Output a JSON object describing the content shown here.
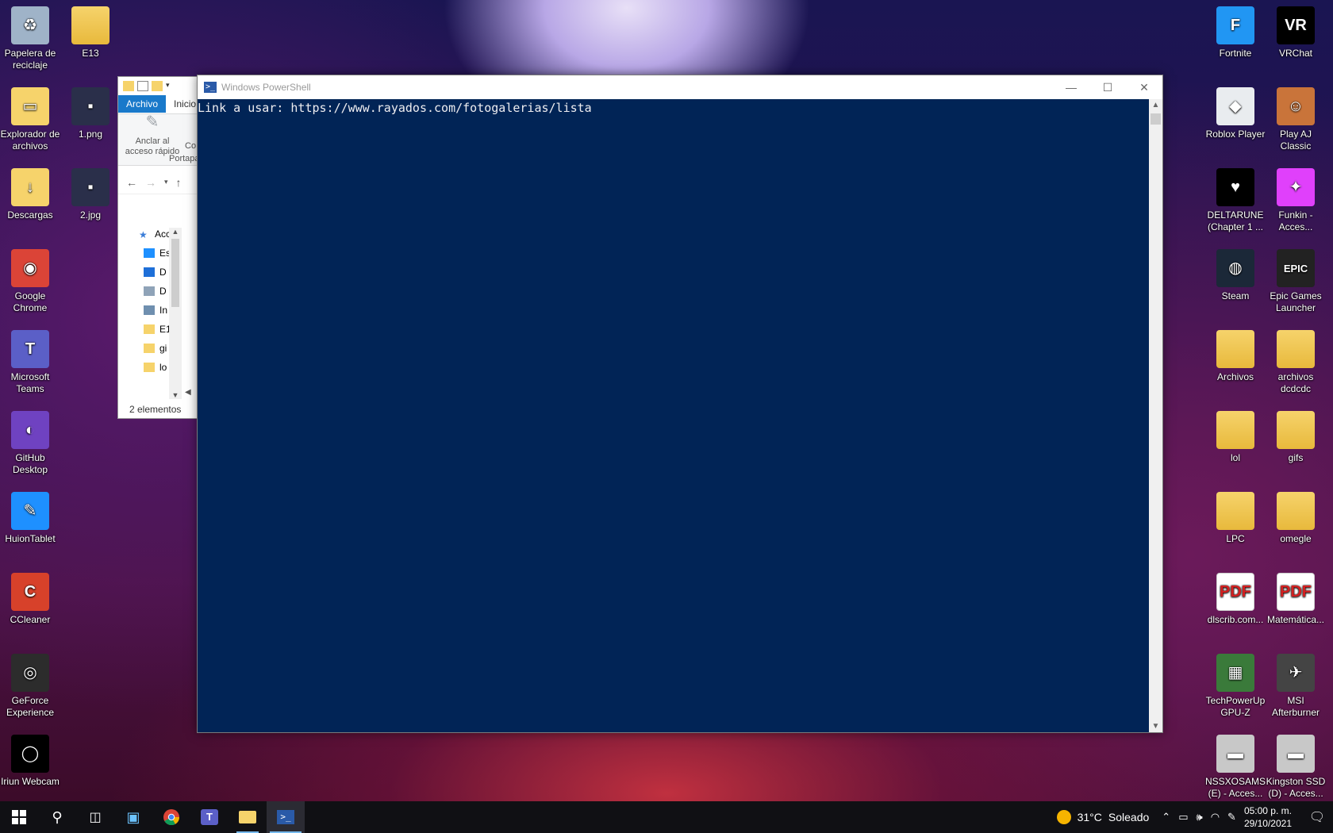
{
  "desktop": {
    "left_icons": [
      {
        "label": "Papelera de reciclaje",
        "icon": "recycle-bin-icon",
        "glyph": "♻"
      },
      {
        "label": "E13",
        "icon": "folder-icon",
        "glyph": ""
      },
      {
        "label": "Explorador de archivos",
        "icon": "file-explorer-icon",
        "glyph": "▭"
      },
      {
        "label": "1.png",
        "icon": "image-file-icon",
        "glyph": "▪"
      },
      {
        "label": "Descargas",
        "icon": "downloads-folder-icon",
        "glyph": "↓"
      },
      {
        "label": "2.jpg",
        "icon": "image-file-icon",
        "glyph": "▪"
      },
      {
        "label": "Google Chrome",
        "icon": "chrome-icon",
        "glyph": "◉"
      },
      {
        "label": "Microsoft Teams",
        "icon": "teams-icon",
        "glyph": "T"
      },
      {
        "label": "GitHub Desktop",
        "icon": "github-icon",
        "glyph": "◐"
      },
      {
        "label": "HuionTablet",
        "icon": "huion-tablet-icon",
        "glyph": "✎"
      },
      {
        "label": "CCleaner",
        "icon": "ccleaner-icon",
        "glyph": "C"
      },
      {
        "label": "GeForce Experience",
        "icon": "geforce-icon",
        "glyph": "◎"
      },
      {
        "label": "Iriun Webcam",
        "icon": "iriun-webcam-icon",
        "glyph": "◯"
      }
    ],
    "right_icons": [
      {
        "label": "Fortnite",
        "icon": "fortnite-icon",
        "glyph": "F"
      },
      {
        "label": "VRChat",
        "icon": "vrchat-icon",
        "glyph": "VR"
      },
      {
        "label": "Roblox Player",
        "icon": "roblox-icon",
        "glyph": "◆"
      },
      {
        "label": "Play AJ Classic",
        "icon": "aj-classic-icon",
        "glyph": "☺"
      },
      {
        "label": "DELTARUNE (Chapter 1 ...",
        "icon": "deltarune-icon",
        "glyph": "♥"
      },
      {
        "label": "Funkin - Acces...",
        "icon": "funkin-icon",
        "glyph": "✦"
      },
      {
        "label": "Steam",
        "icon": "steam-icon",
        "glyph": "◍"
      },
      {
        "label": "Epic Games Launcher",
        "icon": "epic-games-icon",
        "glyph": "EPIC"
      },
      {
        "label": "Archivos",
        "icon": "folder-icon",
        "glyph": ""
      },
      {
        "label": "archivos dcdcdc",
        "icon": "folder-icon",
        "glyph": ""
      },
      {
        "label": "lol",
        "icon": "folder-icon",
        "glyph": ""
      },
      {
        "label": "gifs",
        "icon": "folder-icon",
        "glyph": ""
      },
      {
        "label": "LPC",
        "icon": "folder-icon",
        "glyph": ""
      },
      {
        "label": "omegle",
        "icon": "folder-icon",
        "glyph": ""
      },
      {
        "label": "dlscrib.com...",
        "icon": "pdf-icon",
        "glyph": "PDF"
      },
      {
        "label": "Matemática...",
        "icon": "pdf-icon",
        "glyph": "PDF"
      },
      {
        "label": "TechPowerUp GPU-Z",
        "icon": "gpu-z-icon",
        "glyph": "▦"
      },
      {
        "label": "MSI Afterburner",
        "icon": "msi-afterburner-icon",
        "glyph": "✈"
      },
      {
        "label": "NSSXOSAMS (E) - Acces...",
        "icon": "drive-icon",
        "glyph": "▬"
      },
      {
        "label": "Kingston SSD (D) - Acces...",
        "icon": "drive-icon",
        "glyph": "▬"
      }
    ]
  },
  "explorer": {
    "tab_archivo": "Archivo",
    "tab_inicio": "Inicio",
    "pin_label": "Anclar al acceso rápido",
    "co_label": "Co",
    "group_label": "Portapa",
    "tree": [
      {
        "label": "Acc",
        "icon": "quick-access-star-icon"
      },
      {
        "label": "Es",
        "icon": "desktop-folder-icon"
      },
      {
        "label": "D",
        "icon": "downloads-arrow-icon"
      },
      {
        "label": "D",
        "icon": "documents-icon"
      },
      {
        "label": "In",
        "icon": "pictures-icon"
      },
      {
        "label": "E1",
        "icon": "folder-icon"
      },
      {
        "label": "gi",
        "icon": "folder-icon"
      },
      {
        "label": "lo",
        "icon": "folder-icon"
      }
    ],
    "status": "2 elementos"
  },
  "powershell": {
    "title": "Windows PowerShell",
    "console_text": "Link a usar: https://www.rayados.com/fotogalerias/lista"
  },
  "taskbar": {
    "weather_temp": "31°C",
    "weather_text": "Soleado",
    "time": "05:00 p. m.",
    "date": "29/10/2021"
  },
  "colors": {
    "console_bg": "#012456",
    "console_fg": "#eeedf0",
    "ribbon_accent": "#1979ca",
    "taskbar_bg": "#101014",
    "taskbar_indicator": "#76b9ed"
  }
}
